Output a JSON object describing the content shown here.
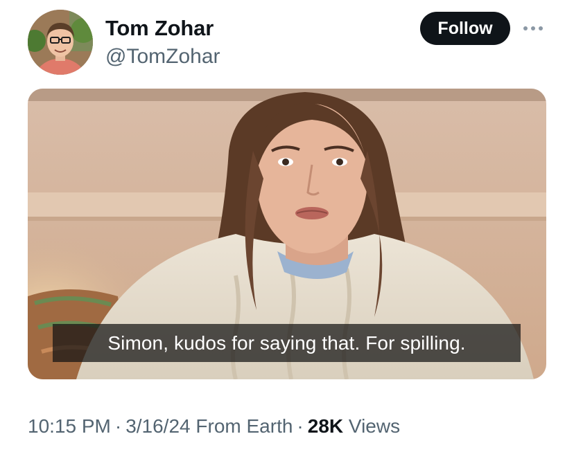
{
  "author": {
    "name": "Tom Zohar",
    "handle": "@TomZohar"
  },
  "header": {
    "follow_label": "Follow",
    "more_icon": "more-horizontal-icon"
  },
  "media": {
    "subtitle": "Simon, kudos for saying that. For spilling."
  },
  "meta": {
    "time": "10:15 PM",
    "separator": "·",
    "date": "3/16/24",
    "location": "From Earth",
    "views_count": "28K",
    "views_label": "Views"
  },
  "colors": {
    "text_primary": "#0f1419",
    "text_secondary": "#536471",
    "follow_bg": "#0f1419",
    "follow_text": "#ffffff"
  }
}
